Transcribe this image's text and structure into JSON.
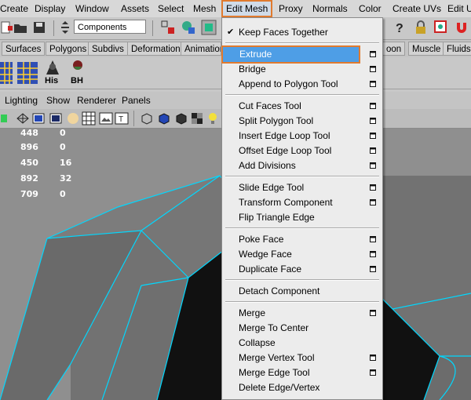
{
  "menubar": {
    "items": [
      "Create",
      "Display",
      "Window",
      "Assets",
      "Select",
      "Mesh",
      "Edit Mesh",
      "Proxy",
      "Normals",
      "Color",
      "Create UVs",
      "Edit U"
    ]
  },
  "statusline": {
    "mode_field": "Components"
  },
  "shelf_tabs": [
    "Surfaces",
    "Polygons",
    "Subdivs",
    "Deformation",
    "Animation",
    "oon",
    "Muscle",
    "Fluids"
  ],
  "shelf_icons": {
    "his_label": "His",
    "bh_label": "BH"
  },
  "panel_menu": [
    "Lighting",
    "Show",
    "Renderer",
    "Panels"
  ],
  "hud": {
    "rows": [
      [
        "448",
        "0"
      ],
      [
        "896",
        "0"
      ],
      [
        "450",
        "16"
      ],
      [
        "892",
        "32"
      ],
      [
        "709",
        "0"
      ]
    ]
  },
  "edit_mesh_menu": {
    "items": [
      {
        "label": "Keep Faces Together",
        "checked": true,
        "option_box": false
      },
      {
        "label": "Extrude",
        "option_box": true,
        "highlighted": true
      },
      {
        "label": "Bridge",
        "option_box": true
      },
      {
        "label": "Append to Polygon Tool",
        "option_box": true
      },
      {
        "label": "Cut Faces Tool",
        "option_box": true
      },
      {
        "label": "Split Polygon Tool",
        "option_box": true
      },
      {
        "label": "Insert Edge Loop Tool",
        "option_box": true
      },
      {
        "label": "Offset Edge Loop Tool",
        "option_box": true
      },
      {
        "label": "Add Divisions",
        "option_box": true
      },
      {
        "label": "Slide Edge Tool",
        "option_box": true
      },
      {
        "label": "Transform Component",
        "option_box": true
      },
      {
        "label": "Flip Triangle Edge",
        "option_box": false
      },
      {
        "label": "Poke Face",
        "option_box": true
      },
      {
        "label": "Wedge Face",
        "option_box": true
      },
      {
        "label": "Duplicate Face",
        "option_box": true
      },
      {
        "label": "Detach Component",
        "option_box": false
      },
      {
        "label": "Merge",
        "option_box": true
      },
      {
        "label": "Merge To Center",
        "option_box": false
      },
      {
        "label": "Collapse",
        "option_box": false
      },
      {
        "label": "Merge Vertex Tool",
        "option_box": true
      },
      {
        "label": "Merge Edge Tool",
        "option_box": true
      },
      {
        "label": "Delete Edge/Vertex",
        "option_box": false
      }
    ]
  },
  "colors": {
    "highlight": "#4e9ee6",
    "accent_outline": "#e07a2e",
    "wire": "#00d8ff",
    "mesh_face": "#6e6e6e",
    "mesh_hole": "#111111"
  }
}
